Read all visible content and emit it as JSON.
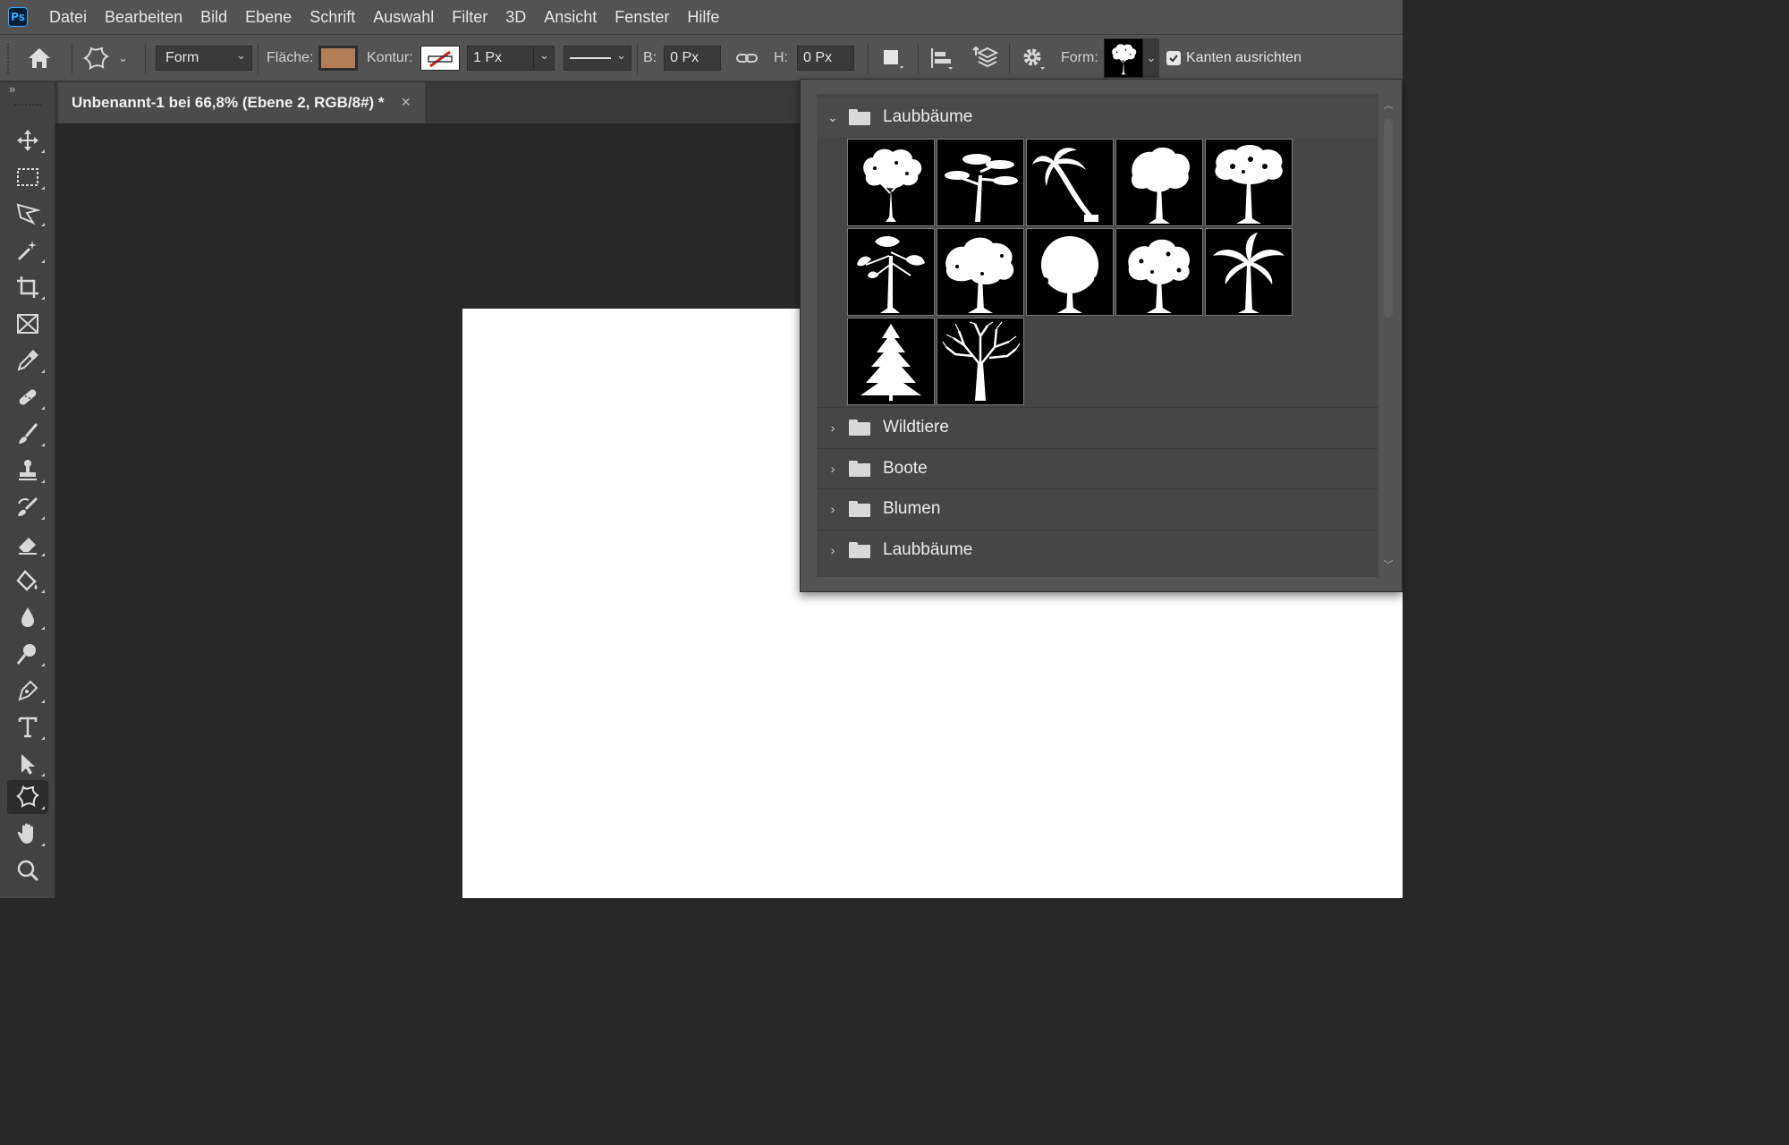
{
  "menubar": {
    "logo": "Ps",
    "items": [
      "Datei",
      "Bearbeiten",
      "Bild",
      "Ebene",
      "Schrift",
      "Auswahl",
      "Filter",
      "3D",
      "Ansicht",
      "Fenster",
      "Hilfe"
    ]
  },
  "options": {
    "mode_value": "Form",
    "fill_label": "Fläche:",
    "fill_color": "#b27e58",
    "stroke_label": "Kontur:",
    "stroke_width": "1 Px",
    "width_label": "B:",
    "width_value": "0 Px",
    "height_label": "H:",
    "height_value": "0 Px",
    "shape_label": "Form:",
    "align_edges_label": "Kanten ausrichten",
    "align_edges_checked": true
  },
  "document": {
    "tab_title": "Unbenannt-1 bei 66,8% (Ebene 2, RGB/8#) *",
    "close_glyph": "×"
  },
  "toolbar": {
    "expand_glyph": "»",
    "tools": [
      "move-tool",
      "marquee-tool",
      "lasso-tool",
      "magic-wand-tool",
      "crop-tool",
      "frame-tool",
      "eyedropper-tool",
      "healing-tool",
      "brush-tool",
      "stamp-tool",
      "history-brush-tool",
      "eraser-tool",
      "paint-bucket-tool",
      "blur-tool",
      "dodge-tool",
      "pen-tool",
      "type-tool",
      "path-selection-tool",
      "custom-shape-tool",
      "hand-tool",
      "zoom-tool"
    ],
    "active_tool": "custom-shape-tool"
  },
  "shape_picker": {
    "groups": [
      {
        "name": "Laubbäume",
        "expanded": true,
        "shape_count": 12
      },
      {
        "name": "Wildtiere",
        "expanded": false
      },
      {
        "name": "Boote",
        "expanded": false
      },
      {
        "name": "Blumen",
        "expanded": false
      },
      {
        "name": "Laubbäume",
        "expanded": false
      }
    ],
    "shapes": [
      "tree-shape-1",
      "tree-shape-2",
      "palm-shape-1",
      "tree-shape-3",
      "tree-shape-4",
      "tree-shape-5",
      "tree-shape-6",
      "tree-shape-7",
      "tree-shape-8",
      "palm-shape-2",
      "fir-shape",
      "bare-tree-shape"
    ]
  }
}
